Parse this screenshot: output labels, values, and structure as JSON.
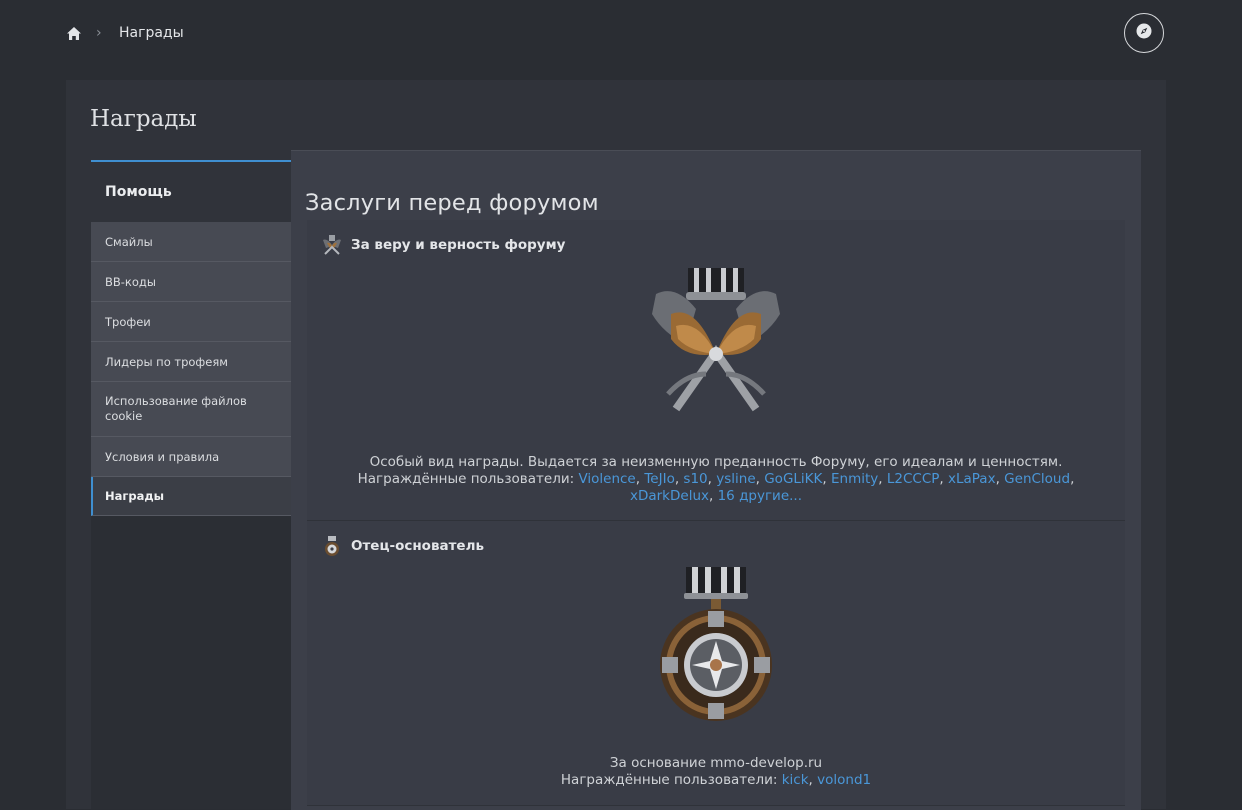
{
  "breadcrumb": {
    "current": "Награды"
  },
  "page": {
    "title": "Награды"
  },
  "sidebar": {
    "heading": "Помощь",
    "items": [
      {
        "label": "Смайлы"
      },
      {
        "label": "BB-коды"
      },
      {
        "label": "Трофеи"
      },
      {
        "label": "Лидеры по трофеям"
      },
      {
        "label": "Использование файлов cookie"
      },
      {
        "label": "Условия и правила"
      },
      {
        "label": "Награды",
        "active": true
      }
    ]
  },
  "category": {
    "title": "Заслуги перед форумом"
  },
  "awards": [
    {
      "name": "За веру и верность форуму",
      "description": "Особый вид награды. Выдается за неизменную преданность Форуму, его идеалам и ценностям.",
      "recipients_label": "Награждённые пользователи:",
      "recipients": [
        "Violence",
        "TeJIo",
        "s10",
        "ysline",
        "GoGLiKK",
        "Enmity",
        "L2CCCP",
        "xLaPax",
        "GenCloud",
        "xDarkDelux"
      ],
      "more_label": "16 другие..."
    },
    {
      "name": "Отец-основатель",
      "description": "За основание mmo-develop.ru",
      "recipients_label": "Награждённые пользователи:",
      "recipients": [
        "kick",
        "volond1"
      ]
    }
  ],
  "colors": {
    "accent": "#3f8fd0",
    "link": "#4a97d8",
    "background": "#2a2d33"
  },
  "icons": [
    "home-icon",
    "chevron-right-icon",
    "compass-icon",
    "award-icon",
    "medal-image"
  ]
}
